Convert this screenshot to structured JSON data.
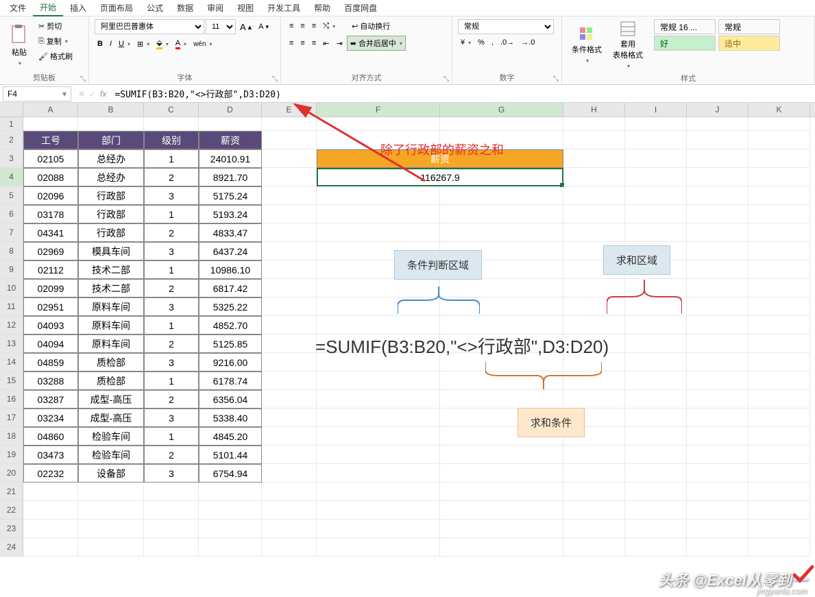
{
  "menu": {
    "items": [
      "文件",
      "开始",
      "插入",
      "页面布局",
      "公式",
      "数据",
      "审阅",
      "视图",
      "开发工具",
      "帮助",
      "百度网盘"
    ],
    "active": 1
  },
  "ribbon": {
    "clipboard": {
      "paste": "粘贴",
      "cut": "剪切",
      "copy": "复制",
      "format_painter": "格式刷",
      "label": "剪贴板"
    },
    "font": {
      "name": "阿里巴巴普惠体",
      "size": "11",
      "label": "字体"
    },
    "align": {
      "wrap": "自动换行",
      "merge": "合并后居中",
      "label": "对齐方式"
    },
    "number": {
      "format": "常规",
      "label": "数字"
    },
    "styles": {
      "cond": "条件格式",
      "tablefmt": "套用\n表格格式",
      "s1": "常规 16 ...",
      "s2": "常规",
      "s3": "好",
      "s4": "适中",
      "label": "样式"
    }
  },
  "formula_bar": {
    "cell_ref": "F4",
    "formula": "=SUMIF(B3:B20,\"<>行政部\",D3:D20)"
  },
  "columns": [
    "A",
    "B",
    "C",
    "D",
    "E",
    "F",
    "G",
    "H",
    "I",
    "J",
    "K"
  ],
  "table": {
    "headers": [
      "工号",
      "部门",
      "级别",
      "薪资"
    ],
    "rows": [
      [
        "02105",
        "总经办",
        "1",
        "24010.91"
      ],
      [
        "02088",
        "总经办",
        "2",
        "8921.70"
      ],
      [
        "02096",
        "行政部",
        "3",
        "5175.24"
      ],
      [
        "03178",
        "行政部",
        "1",
        "5193.24"
      ],
      [
        "04341",
        "行政部",
        "2",
        "4833.47"
      ],
      [
        "02969",
        "模具车间",
        "3",
        "6437.24"
      ],
      [
        "02112",
        "技术二部",
        "1",
        "10986.10"
      ],
      [
        "02099",
        "技术二部",
        "2",
        "6817.42"
      ],
      [
        "02951",
        "原料车间",
        "3",
        "5325.22"
      ],
      [
        "04093",
        "原料车间",
        "1",
        "4852.70"
      ],
      [
        "04094",
        "原料车间",
        "2",
        "5125.85"
      ],
      [
        "04859",
        "质检部",
        "3",
        "9216.00"
      ],
      [
        "03288",
        "质检部",
        "1",
        "6178.74"
      ],
      [
        "03287",
        "成型-高压",
        "2",
        "6356.04"
      ],
      [
        "03234",
        "成型-高压",
        "3",
        "5338.40"
      ],
      [
        "04860",
        "检验车间",
        "1",
        "4845.20"
      ],
      [
        "03473",
        "检验车间",
        "2",
        "5101.44"
      ],
      [
        "02232",
        "设备部",
        "3",
        "6754.94"
      ]
    ]
  },
  "result_box": {
    "header": "薪资",
    "value": "116267.9"
  },
  "annotations": {
    "title": "除了行政部的薪资之和",
    "range": "条件判断区域",
    "sum_range": "求和区域",
    "criteria": "求和条件",
    "formula": "=SUMIF(B3:B20,\"<>行政部\",D3:D20)"
  },
  "watermark": {
    "line1": "头条 @Excel从零到一",
    "line2": "jingyanla.com"
  }
}
